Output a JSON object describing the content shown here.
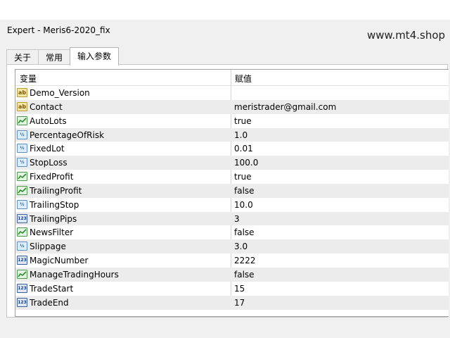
{
  "window": {
    "title": "Expert - Meris6-2020_fix",
    "watermark": "www.mt4.shop"
  },
  "tabs": [
    {
      "label": "关于",
      "active": false
    },
    {
      "label": "常用",
      "active": false
    },
    {
      "label": "输入参数",
      "active": true
    }
  ],
  "table": {
    "headers": {
      "variable": "变量",
      "value": "赋值"
    },
    "rows": [
      {
        "name": "Demo_Version",
        "value": "",
        "icon": "string-icon"
      },
      {
        "name": "Contact",
        "value": "meristrader@gmail.com",
        "icon": "string-icon"
      },
      {
        "name": "AutoLots",
        "value": "true",
        "icon": "bool-icon"
      },
      {
        "name": "PercentageOfRisk",
        "value": "1.0",
        "icon": "double-icon"
      },
      {
        "name": "FixedLot",
        "value": "0.01",
        "icon": "double-icon"
      },
      {
        "name": "StopLoss",
        "value": "100.0",
        "icon": "double-icon"
      },
      {
        "name": "FixedProfit",
        "value": "true",
        "icon": "bool-icon"
      },
      {
        "name": "TrailingProfit",
        "value": "false",
        "icon": "bool-icon"
      },
      {
        "name": "TrailingStop",
        "value": "10.0",
        "icon": "double-icon"
      },
      {
        "name": "TrailingPips",
        "value": "3",
        "icon": "int-icon"
      },
      {
        "name": "NewsFilter",
        "value": "false",
        "icon": "bool-icon"
      },
      {
        "name": "Slippage",
        "value": "3.0",
        "icon": "double-icon"
      },
      {
        "name": "MagicNumber",
        "value": "2222",
        "icon": "int-icon"
      },
      {
        "name": "ManageTradingHours",
        "value": "false",
        "icon": "bool-icon"
      },
      {
        "name": "TradeStart",
        "value": "15",
        "icon": "int-icon"
      },
      {
        "name": "TradeEnd",
        "value": "17",
        "icon": "int-icon"
      }
    ]
  }
}
